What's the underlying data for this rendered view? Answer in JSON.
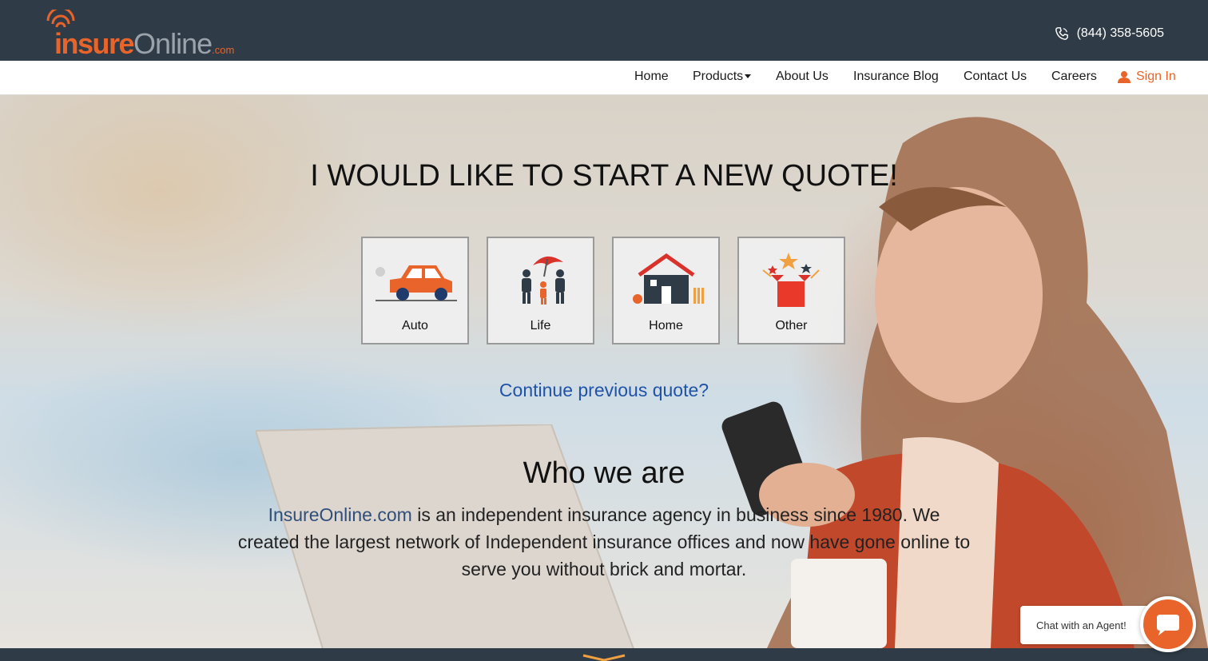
{
  "header": {
    "logo": {
      "insure": "insure",
      "online": "Online",
      "com": ".com"
    },
    "phone": "(844) 358-5605",
    "phone_icon": "phone-icon"
  },
  "nav": {
    "items": [
      {
        "label": "Home"
      },
      {
        "label": "Products"
      },
      {
        "label": "About Us"
      },
      {
        "label": "Insurance Blog"
      },
      {
        "label": "Contact Us"
      },
      {
        "label": "Careers"
      }
    ],
    "sign_in": "Sign In",
    "sign_in_icon": "user-icon"
  },
  "hero": {
    "title": "I WOULD LIKE TO START A NEW QUOTE!",
    "cards": [
      {
        "label": "Auto",
        "icon": "car-icon"
      },
      {
        "label": "Life",
        "icon": "family-umbrella-icon"
      },
      {
        "label": "Home",
        "icon": "house-icon"
      },
      {
        "label": "Other",
        "icon": "gift-box-icon"
      }
    ],
    "continue_link": "Continue previous quote?"
  },
  "who": {
    "title": "Who we are",
    "link": "InsureOnline.com",
    "text": " is an independent insurance agency in business since 1980. We created the largest network of Independent insurance offices and now have gone online to serve you without brick and mortar."
  },
  "chat": {
    "label": "Chat with an Agent!",
    "icon": "chat-bubble-icon"
  },
  "colors": {
    "brand_orange": "#e8642a",
    "header_bg": "#2f3b46",
    "link_blue": "#1f53a8"
  }
}
